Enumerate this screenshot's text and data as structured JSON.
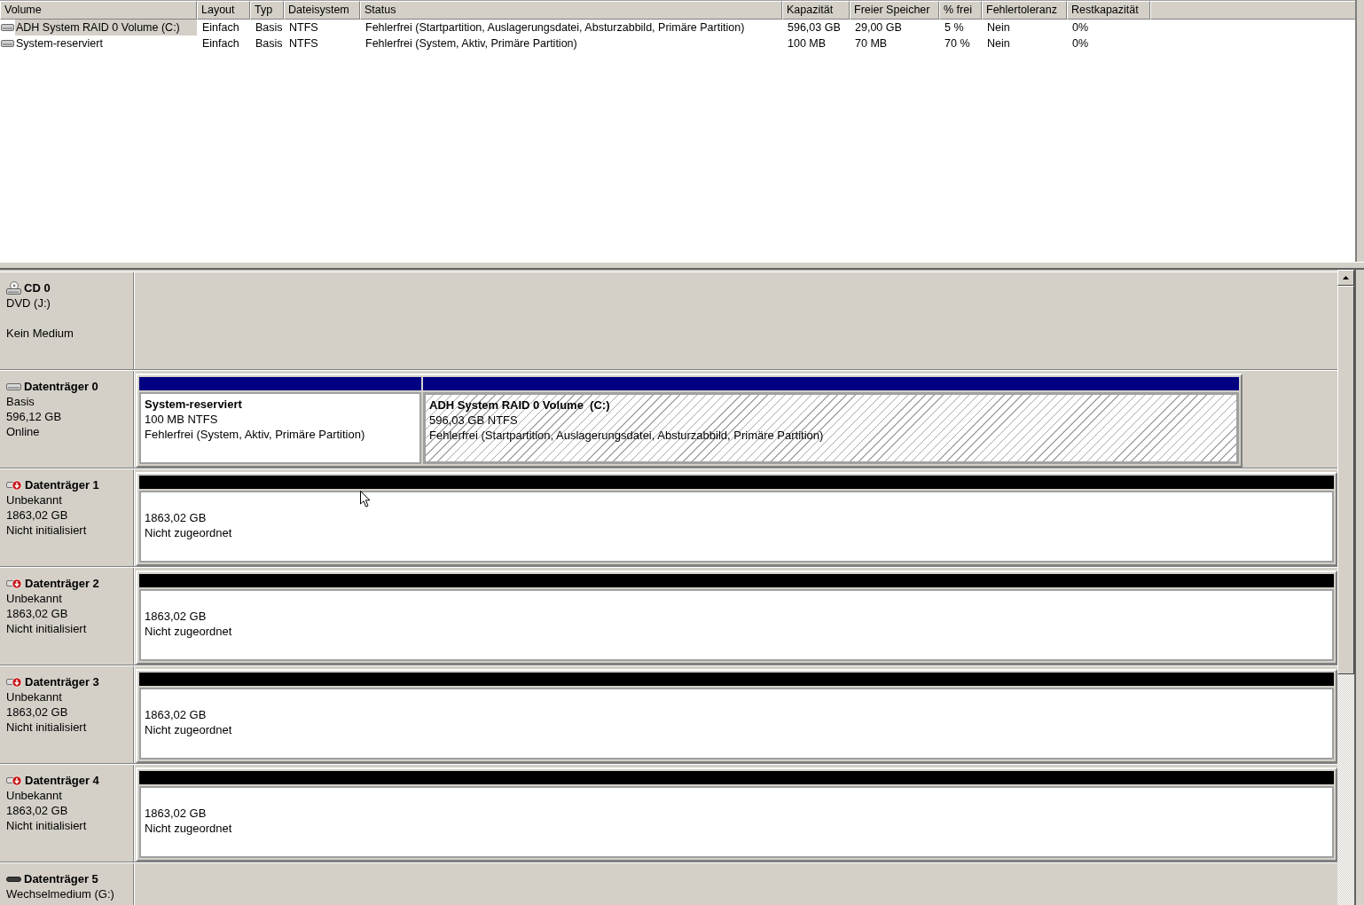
{
  "volume_list": {
    "columns": [
      "Volume",
      "Layout",
      "Typ",
      "Dateisystem",
      "Status",
      "Kapazität",
      "Freier Speicher",
      "% frei",
      "Fehlertoleranz",
      "Restkapazität"
    ],
    "rows": [
      {
        "selected": true,
        "cells": [
          "ADH System RAID 0 Volume (C:)",
          "Einfach",
          "Basis",
          "NTFS",
          "Fehlerfrei (Startpartition, Auslagerungsdatei, Absturzabbild, Primäre Partition)",
          "596,03 GB",
          "29,00 GB",
          "5 %",
          "Nein",
          "0%"
        ]
      },
      {
        "selected": false,
        "cells": [
          "System-reserviert",
          "Einfach",
          "Basis",
          "NTFS",
          "Fehlerfrei (System, Aktiv, Primäre Partition)",
          "100 MB",
          "70 MB",
          "70 %",
          "Nein",
          "0%"
        ]
      }
    ]
  },
  "disks": [
    {
      "kind": "cdrom",
      "title": "CD 0",
      "type": "DVD (J:)",
      "status": "Kein Medium"
    },
    {
      "kind": "basic",
      "title": "Datenträger 0",
      "type": "Basis",
      "size": "596,12 GB",
      "status": "Online",
      "partitions": [
        {
          "kind": "primary",
          "selected": false,
          "name": "System-reserviert",
          "size": "100 MB NTFS",
          "status": "Fehlerfrei (System, Aktiv, Primäre Partition)"
        },
        {
          "kind": "primary",
          "selected": true,
          "name": "ADH System RAID 0 Volume  (C:)",
          "size": "596,03 GB NTFS",
          "status": "Fehlerfrei (Startpartition, Auslagerungsdatei, Absturzabbild, Primäre Partition)"
        }
      ]
    },
    {
      "kind": "unknown",
      "title": "Datenträger 1",
      "type": "Unbekannt",
      "size": "1863,02 GB",
      "status": "Nicht initialisiert",
      "partitions": [
        {
          "kind": "unallocated",
          "selected": false,
          "size": "1863,02 GB",
          "status": "Nicht zugeordnet"
        }
      ]
    },
    {
      "kind": "unknown",
      "title": "Datenträger 2",
      "type": "Unbekannt",
      "size": "1863,02 GB",
      "status": "Nicht initialisiert",
      "partitions": [
        {
          "kind": "unallocated",
          "selected": false,
          "size": "1863,02 GB",
          "status": "Nicht zugeordnet"
        }
      ]
    },
    {
      "kind": "unknown",
      "title": "Datenträger 3",
      "type": "Unbekannt",
      "size": "1863,02 GB",
      "status": "Nicht initialisiert",
      "partitions": [
        {
          "kind": "unallocated",
          "selected": false,
          "size": "1863,02 GB",
          "status": "Nicht zugeordnet"
        }
      ]
    },
    {
      "kind": "unknown",
      "title": "Datenträger 4",
      "type": "Unbekannt",
      "size": "1863,02 GB",
      "status": "Nicht initialisiert",
      "partitions": [
        {
          "kind": "unallocated",
          "selected": false,
          "size": "1863,02 GB",
          "status": "Nicht zugeordnet"
        }
      ]
    },
    {
      "kind": "removable",
      "title": "Datenträger 5",
      "type": "Wechselmedium (G:)"
    }
  ]
}
